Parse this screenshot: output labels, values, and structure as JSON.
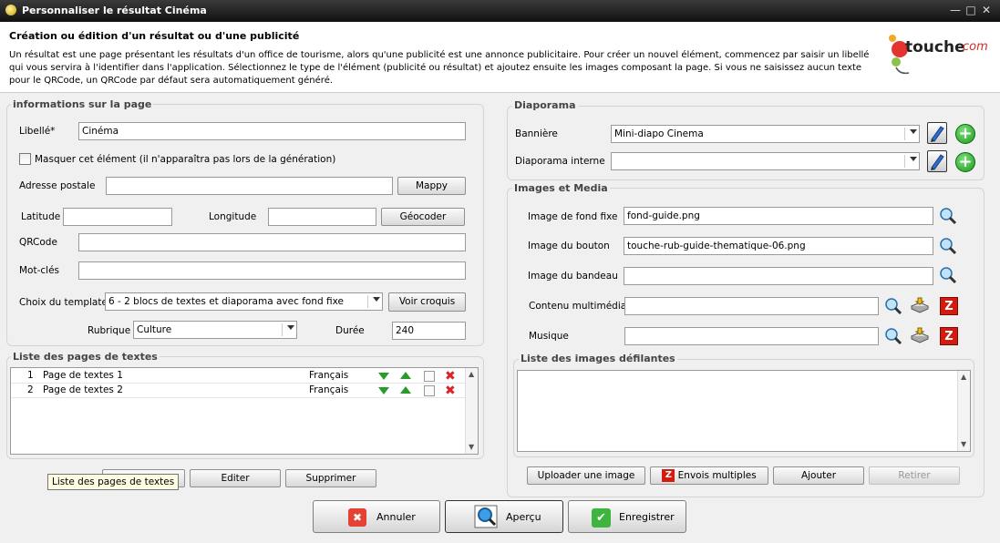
{
  "window": {
    "title": "Personnaliser le résultat Cinéma"
  },
  "header": {
    "title": "Création ou édition d'un résultat ou d'une publicité",
    "description": "Un résultat est une page présentant les résultats d'un office de tourisme, alors qu'une publicité est une annonce publicitaire. Pour créer un nouvel élément, commencez par saisir un libellé qui vous servira à l'identifier dans l'application. Sélectionnez le type de l'élément (publicité ou résultat) et ajoutez ensuite les images composant la page. Si vous ne saisissez aucun texte pour le QRCode, un QRCode par défaut sera automatiquement généré.",
    "logo_text": "touche",
    "logo_suffix": "com"
  },
  "info": {
    "group_title": "informations sur la page",
    "libelle_label": "Libellé*",
    "libelle_value": "Cinéma",
    "masquer_label": "Masquer cet élément (il n'apparaîtra pas lors de la génération)",
    "adresse_label": "Adresse postale",
    "adresse_value": "",
    "mappy_button": "Mappy",
    "latitude_label": "Latitude",
    "latitude_value": "",
    "longitude_label": "Longitude",
    "longitude_value": "",
    "geocoder_button": "Géocoder",
    "qrcode_label": "QRCode",
    "qrcode_value": "",
    "motcles_label": "Mot-clés",
    "motcles_value": "",
    "template_label": "Choix du template",
    "template_value": "6 - 2 blocs de textes et diaporama avec fond fixe",
    "voir_croquis_button": "Voir croquis",
    "rubrique_label": "Rubrique",
    "rubrique_value": "Culture",
    "duree_label": "Durée",
    "duree_value": "240"
  },
  "textes": {
    "group_title": "Liste des pages de textes",
    "rows": [
      {
        "num": "1",
        "name": "Page de textes 1",
        "lang": "Français"
      },
      {
        "num": "2",
        "name": "Page de textes 2",
        "lang": "Français"
      }
    ],
    "editer_button": "Editer",
    "supprimer_button": "Supprimer",
    "tooltip": "Liste des pages de textes"
  },
  "diaporama": {
    "group_title": "Diaporama",
    "banniere_label": "Bannière",
    "banniere_value": "Mini-diapo Cinema",
    "interne_label": "Diaporama interne",
    "interne_value": ""
  },
  "media": {
    "group_title": "Images et Media",
    "fond_label": "Image de fond fixe",
    "fond_value": "fond-guide.png",
    "bouton_label": "Image du bouton",
    "bouton_value": "touche-rub-guide-thematique-06.png",
    "bandeau_label": "Image du bandeau",
    "bandeau_value": "",
    "multimedia_label": "Contenu multimédia",
    "multimedia_value": "",
    "musique_label": "Musique",
    "musique_value": ""
  },
  "defilantes": {
    "group_title": "Liste des images défilantes",
    "uploader_button": "Uploader une image",
    "envois_button": "Envois multiples",
    "ajouter_button": "Ajouter",
    "retirer_button": "Retirer"
  },
  "footer": {
    "annuler": "Annuler",
    "apercu": "Aperçu",
    "enregistrer": "Enregistrer"
  }
}
